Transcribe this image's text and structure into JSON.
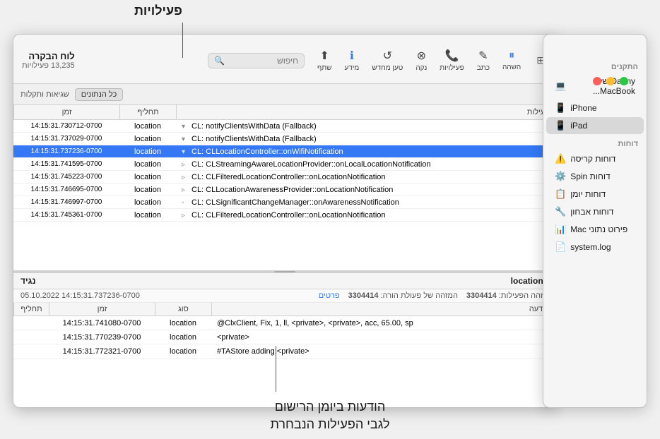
{
  "annotations": {
    "top_label": "פעילויות",
    "bottom_label_line1": "הודעות ביומן הרישום",
    "bottom_label_line2": "לגבי הפעילות הנבחרת"
  },
  "window": {
    "title": "לוח הבקרה",
    "subtitle": "13,235 פעילויות",
    "toolbar": {
      "share": "שתף",
      "info": "מידע",
      "reload": "טען מחדש",
      "clear": "נקה",
      "activities": "פעילויות",
      "write": "כתב",
      "stream": "השהה"
    },
    "search_placeholder": "חיפוש",
    "filter": {
      "all_label": "כל הנתונים",
      "errors_label": "שגיאות ותקלות"
    },
    "table_headers": {
      "activity": "פעילות",
      "type": "תחליף",
      "time": "זמן"
    },
    "rows": [
      {
        "indent": 0,
        "expand": "▾",
        "activity": "CL: notifyClientsWithData (Fallback)",
        "type": "location",
        "time": "14:15:31.730712-0700",
        "selected": false
      },
      {
        "indent": 0,
        "expand": "▾",
        "activity": "CL: notifyClientsWithData (Fallback)",
        "type": "location",
        "time": "14:15:31.737029-0700",
        "selected": false
      },
      {
        "indent": 0,
        "expand": "▾",
        "activity": "CL: CLLocationController::onWifiNotification",
        "type": "location",
        "time": "14:15:31.737236-0700",
        "selected": true
      },
      {
        "indent": 1,
        "expand": "▹",
        "activity": "CL: CLStreamingAwareLocationProvider::onLocalLocationNotification",
        "type": "location",
        "time": "14:15:31.741595-0700",
        "selected": false
      },
      {
        "indent": 2,
        "expand": "▹",
        "activity": "CL: CLFilteredLocationController::onLocationNotification",
        "type": "location",
        "time": "14:15:31.745223-0700",
        "selected": false
      },
      {
        "indent": 3,
        "expand": "▹",
        "activity": "CL: CLLocationAwarenessProvider::onLocationNotification",
        "type": "location",
        "time": "14:15:31.746695-0700",
        "selected": false
      },
      {
        "indent": 4,
        "expand": "◦",
        "activity": "CL: CLSignificantChangeManager::onAwarenessNotification",
        "type": "location",
        "time": "14:15:31.746997-0700",
        "selected": false
      },
      {
        "indent": 1,
        "expand": "▹",
        "activity": "CL: CLFilteredLocationController::onLocationNotification",
        "type": "location",
        "time": "14:15:31.745361-0700",
        "selected": false
      }
    ],
    "detail": {
      "process": "locationd",
      "direction": "נגיד",
      "timestamp": "14:15:31.737236-0700 05.10.2022",
      "count_label": "מזהה הפעילות:",
      "count_value": "3304414",
      "compare_label": "המזהה של פעולת הורה:",
      "compare_value": "3304414",
      "parts_link": "פרטים",
      "detail_headers": {
        "message": "הודעה",
        "type": "סוג",
        "time": "זמן",
        "level": "תחליף"
      },
      "detail_rows": [
        {
          "message": "@ClxClient, Fix, 1, ll, <private>, <private>, acc, 65.00, sp",
          "type": "location",
          "time": "14:15:31.741080-0700",
          "level": ""
        },
        {
          "message": "<private>",
          "type": "location",
          "time": "14:15:31.770239-0700",
          "level": ""
        },
        {
          "message": "#TAStore adding:<private>",
          "type": "location",
          "time": "14:15:31.772321-0700",
          "level": ""
        }
      ]
    }
  },
  "sidebar": {
    "sections": [
      {
        "title": "התקנים",
        "items": [
          {
            "label": "Danny של MacBook...",
            "icon": "💻"
          },
          {
            "label": "iPhone",
            "icon": "📱"
          },
          {
            "label": "iPad",
            "icon": "📱"
          }
        ]
      },
      {
        "title": "דוחות",
        "items": [
          {
            "label": "דוחות קריסה",
            "icon": "⚠️"
          },
          {
            "label": "דוחות Spin",
            "icon": "⚙️"
          },
          {
            "label": "דוחות יומן",
            "icon": "📋"
          },
          {
            "label": "דוחות אבחון",
            "icon": "🔧"
          },
          {
            "label": "פירוט נתוני Mac",
            "icon": "📊"
          },
          {
            "label": "system.log",
            "icon": "📄"
          }
        ]
      }
    ]
  }
}
